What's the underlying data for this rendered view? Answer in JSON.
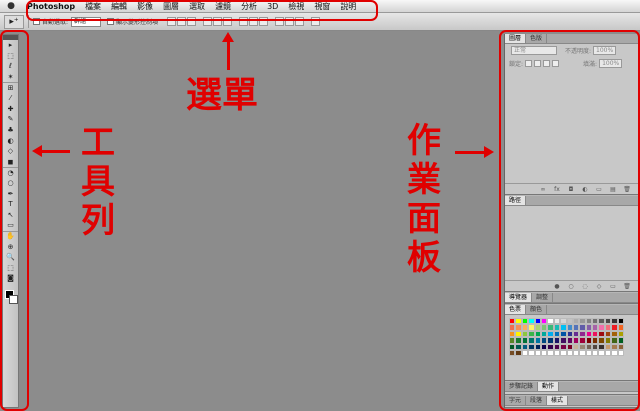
{
  "menubar": {
    "apple": "",
    "items": [
      "Photoshop",
      "檔案",
      "編輯",
      "影像",
      "圖層",
      "選取",
      "濾鏡",
      "分析",
      "3D",
      "檢視",
      "視窗",
      "說明"
    ]
  },
  "options": {
    "tool_icon": "▸⁺",
    "auto_select_label": "自動選取:",
    "auto_select_value": "群組",
    "transform_label": "顯示變形控制項"
  },
  "toolbar": {
    "tools": [
      "▸",
      "⬚",
      "ℓ",
      "✶",
      "⊞",
      "⁄",
      "✚",
      "✎",
      "♣",
      "◐",
      "◇",
      "◼",
      "◔",
      "○",
      "✒",
      "T",
      "↖",
      "▭",
      "✋",
      "⊕",
      "🔍",
      "⬚",
      "◙"
    ]
  },
  "panels": {
    "layers": {
      "tabs": [
        "圖層",
        "色版"
      ],
      "blend_mode": "正常",
      "opacity_label": "不透明度:",
      "opacity_value": "100%",
      "lock_label": "鎖定:",
      "fill_label": "填滿:",
      "fill_value": "100%",
      "footer_icons": [
        "∞",
        "fx",
        "◘",
        "◐",
        "▭",
        "▤",
        "🗑"
      ]
    },
    "paths": {
      "tabs": [
        "路徑"
      ],
      "footer_icons": [
        "●",
        "○",
        "◌",
        "◇",
        "▭",
        "🗑"
      ]
    },
    "navigator": {
      "tabs": [
        "導覽器",
        "調整"
      ]
    },
    "swatches": {
      "tabs": [
        "色票",
        "顏色"
      ]
    },
    "history": {
      "tabs": [
        "步驟記錄",
        "動作"
      ]
    },
    "text": {
      "tabs": [
        "字元",
        "段落",
        "樣式"
      ]
    }
  },
  "annotations": {
    "menu": "選單",
    "toolbar": [
      "工",
      "具",
      "列"
    ],
    "panels": [
      "作",
      "業",
      "面",
      "板"
    ]
  },
  "colors": {
    "accent": "#e00000",
    "workspace": "#8c8c8c"
  },
  "swatch_colors": [
    "#ff0000",
    "#ffff00",
    "#00ff00",
    "#00ffff",
    "#0000ff",
    "#ff00ff",
    "#ffffff",
    "#ebebeb",
    "#d6d6d6",
    "#c2c2c2",
    "#adadad",
    "#999999",
    "#858585",
    "#707070",
    "#5c5c5c",
    "#474747",
    "#333333",
    "#000000",
    "#f26c4f",
    "#f68e55",
    "#fbaf5c",
    "#fff467",
    "#acd372",
    "#7cc576",
    "#3bb878",
    "#1abbb4",
    "#00bff3",
    "#438ccb",
    "#5574b9",
    "#605ca8",
    "#855fa8",
    "#a763a8",
    "#f06eaa",
    "#f26d7d",
    "#ed1c24",
    "#f26522",
    "#f7941d",
    "#fff200",
    "#8dc73f",
    "#39b54a",
    "#00a651",
    "#00a99d",
    "#00aeef",
    "#0072bc",
    "#0054a6",
    "#2e3192",
    "#662d91",
    "#92278f",
    "#ec008c",
    "#ed145b",
    "#9e0b0f",
    "#a0410d",
    "#a3620a",
    "#aba000",
    "#598527",
    "#1a7b30",
    "#007236",
    "#00746b",
    "#0076a3",
    "#004b80",
    "#003471",
    "#1b1464",
    "#440e62",
    "#630460",
    "#9e005d",
    "#9e0039",
    "#790000",
    "#7b2e00",
    "#7d4900",
    "#827b00",
    "#406618",
    "#005e20",
    "#005826",
    "#005952",
    "#005b7f",
    "#003663",
    "#002157",
    "#0d004c",
    "#32004b",
    "#4b0049",
    "#7b0046",
    "#7a0026",
    "#c7b299",
    "#998675",
    "#736357",
    "#534741",
    "#37302d",
    "#c69c6d",
    "#a67c52",
    "#8c6239",
    "#754c24",
    "#603913",
    "#ffffff",
    "#ffffff",
    "#ffffff",
    "#ffffff",
    "#ffffff",
    "#ffffff",
    "#ffffff",
    "#ffffff",
    "#ffffff",
    "#ffffff",
    "#ffffff",
    "#ffffff",
    "#ffffff",
    "#ffffff",
    "#ffffff",
    "#ffffff"
  ]
}
